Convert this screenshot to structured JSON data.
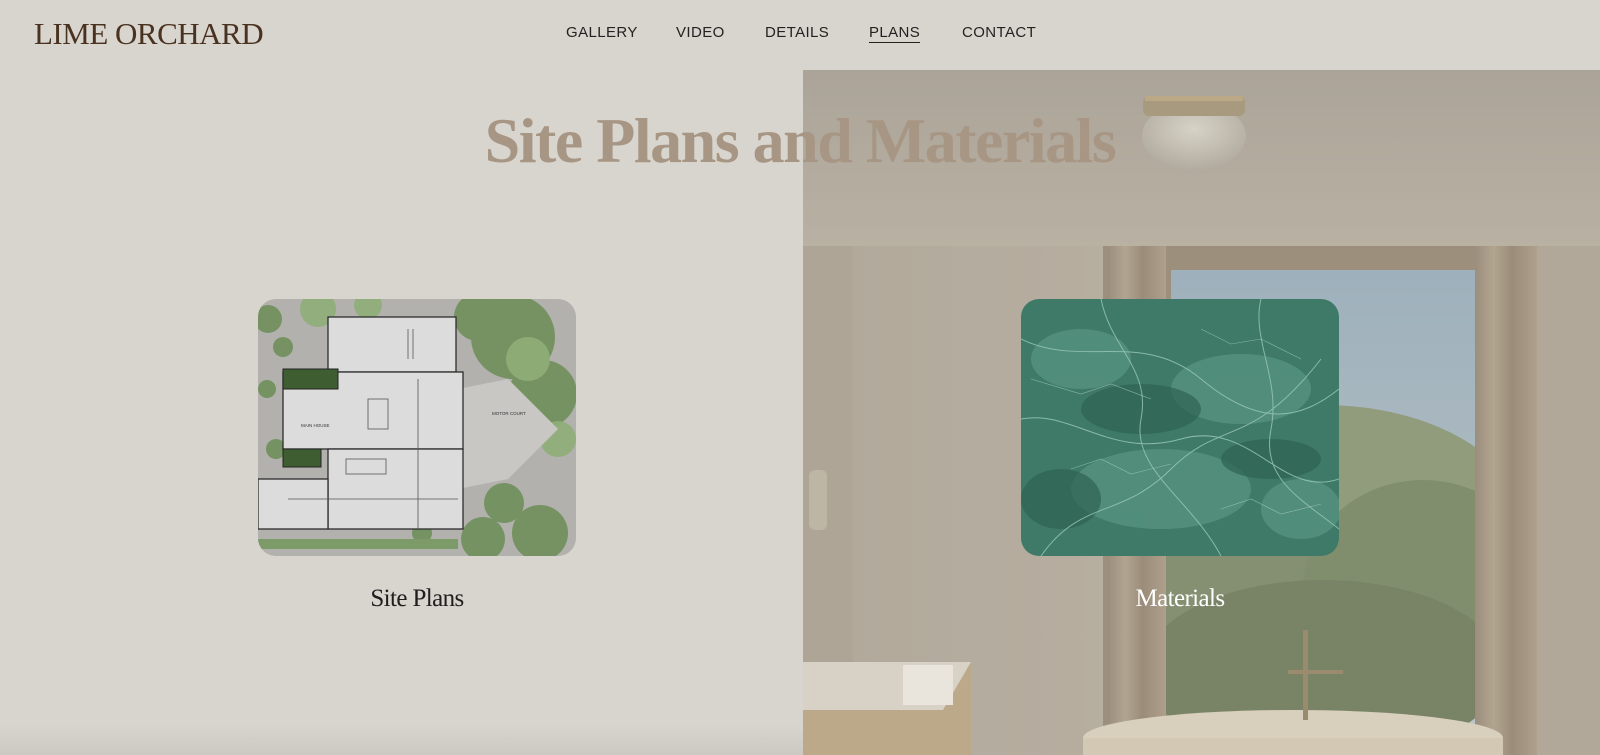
{
  "brand": {
    "logo": "LIME ORCHARD"
  },
  "nav": {
    "items": [
      {
        "label": "GALLERY",
        "active": false
      },
      {
        "label": "VIDEO",
        "active": false
      },
      {
        "label": "DETAILS",
        "active": false
      },
      {
        "label": "PLANS",
        "active": true
      },
      {
        "label": "CONTACT",
        "active": false
      }
    ]
  },
  "section": {
    "title": "Site Plans and Materials"
  },
  "cards": [
    {
      "label": "Site Plans",
      "thumb": {
        "annotations": [
          "MAIN HOUSE",
          "MOTOR COURT"
        ]
      }
    },
    {
      "label": "Materials"
    }
  ],
  "colors": {
    "background": "#d8d4ce",
    "logo": "#4a3220",
    "title": "#a89684",
    "marble": "#3f7a68"
  }
}
